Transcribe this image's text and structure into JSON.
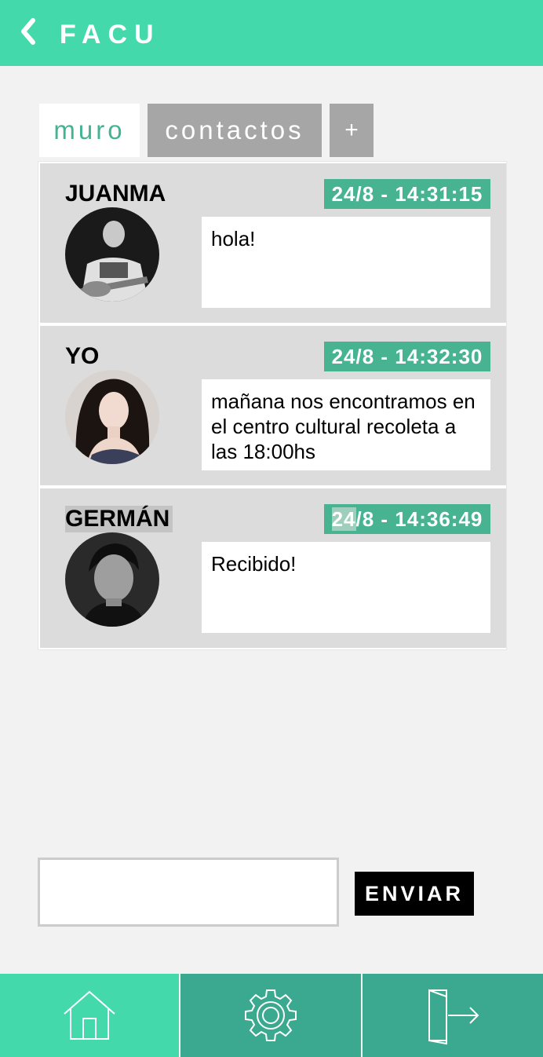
{
  "header": {
    "title": "FACU",
    "back_icon": "chevron-left-icon"
  },
  "tabs": [
    {
      "label": "muro",
      "active": true
    },
    {
      "label": "contactos",
      "active": false
    },
    {
      "label": "+",
      "active": false
    }
  ],
  "messages": [
    {
      "name": "JUANMA",
      "time": "24/8 - 14:31:15",
      "text": "hola!"
    },
    {
      "name": "YO",
      "time": "24/8 - 14:32:30",
      "text": "mañana nos encontramos en el centro cultural recoleta a las 18:00hs"
    },
    {
      "name": "GERMÁN",
      "time_selected": "24",
      "time_rest": "/8 - 14:36:49",
      "text": "Recibido!"
    }
  ],
  "composer": {
    "input_value": "",
    "input_placeholder": "",
    "send_label": "ENVIAR"
  },
  "bottom_nav": [
    {
      "icon": "home-icon"
    },
    {
      "icon": "gear-icon"
    },
    {
      "icon": "logout-icon"
    }
  ],
  "colors": {
    "accent": "#43d9ab",
    "accent_dark": "#3aa98f",
    "timestamp_bg": "#47b390",
    "tab_inactive": "#a6a6a6",
    "message_bg": "#dcdcdc",
    "page_bg": "#f2f2f2"
  }
}
